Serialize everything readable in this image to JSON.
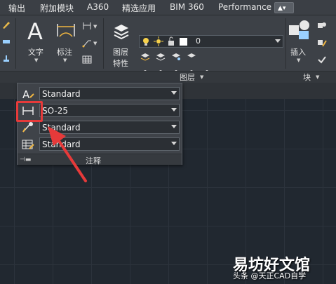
{
  "tabs": [
    {
      "label": "输出"
    },
    {
      "label": "附加模块"
    },
    {
      "label": "A360"
    },
    {
      "label": "精选应用"
    },
    {
      "label": "BIM 360"
    },
    {
      "label": "Performance"
    }
  ],
  "ribbon": {
    "text_label": "文字",
    "dimension_label": "标注",
    "layer_properties_label_1": "图层",
    "layer_properties_label_2": "特性",
    "layer_combo_value": "0",
    "insert_label": "插入",
    "panel_layers": "图层",
    "panel_block": "块"
  },
  "flyout": {
    "rows": [
      {
        "icon": "text-style-icon",
        "value": "Standard"
      },
      {
        "icon": "dimension-style-icon",
        "value": "SO-25"
      },
      {
        "icon": "multileader-style-icon",
        "value": "Standard"
      },
      {
        "icon": "table-style-icon",
        "value": "Standard"
      }
    ],
    "title": "注释"
  },
  "watermark": {
    "main": "易坊好文馆",
    "sub": "头条 @天正CAD自学"
  },
  "colors": {
    "accent_red": "#e63a3a",
    "ribbon_bg": "#3d4147",
    "canvas_bg": "#212830"
  }
}
